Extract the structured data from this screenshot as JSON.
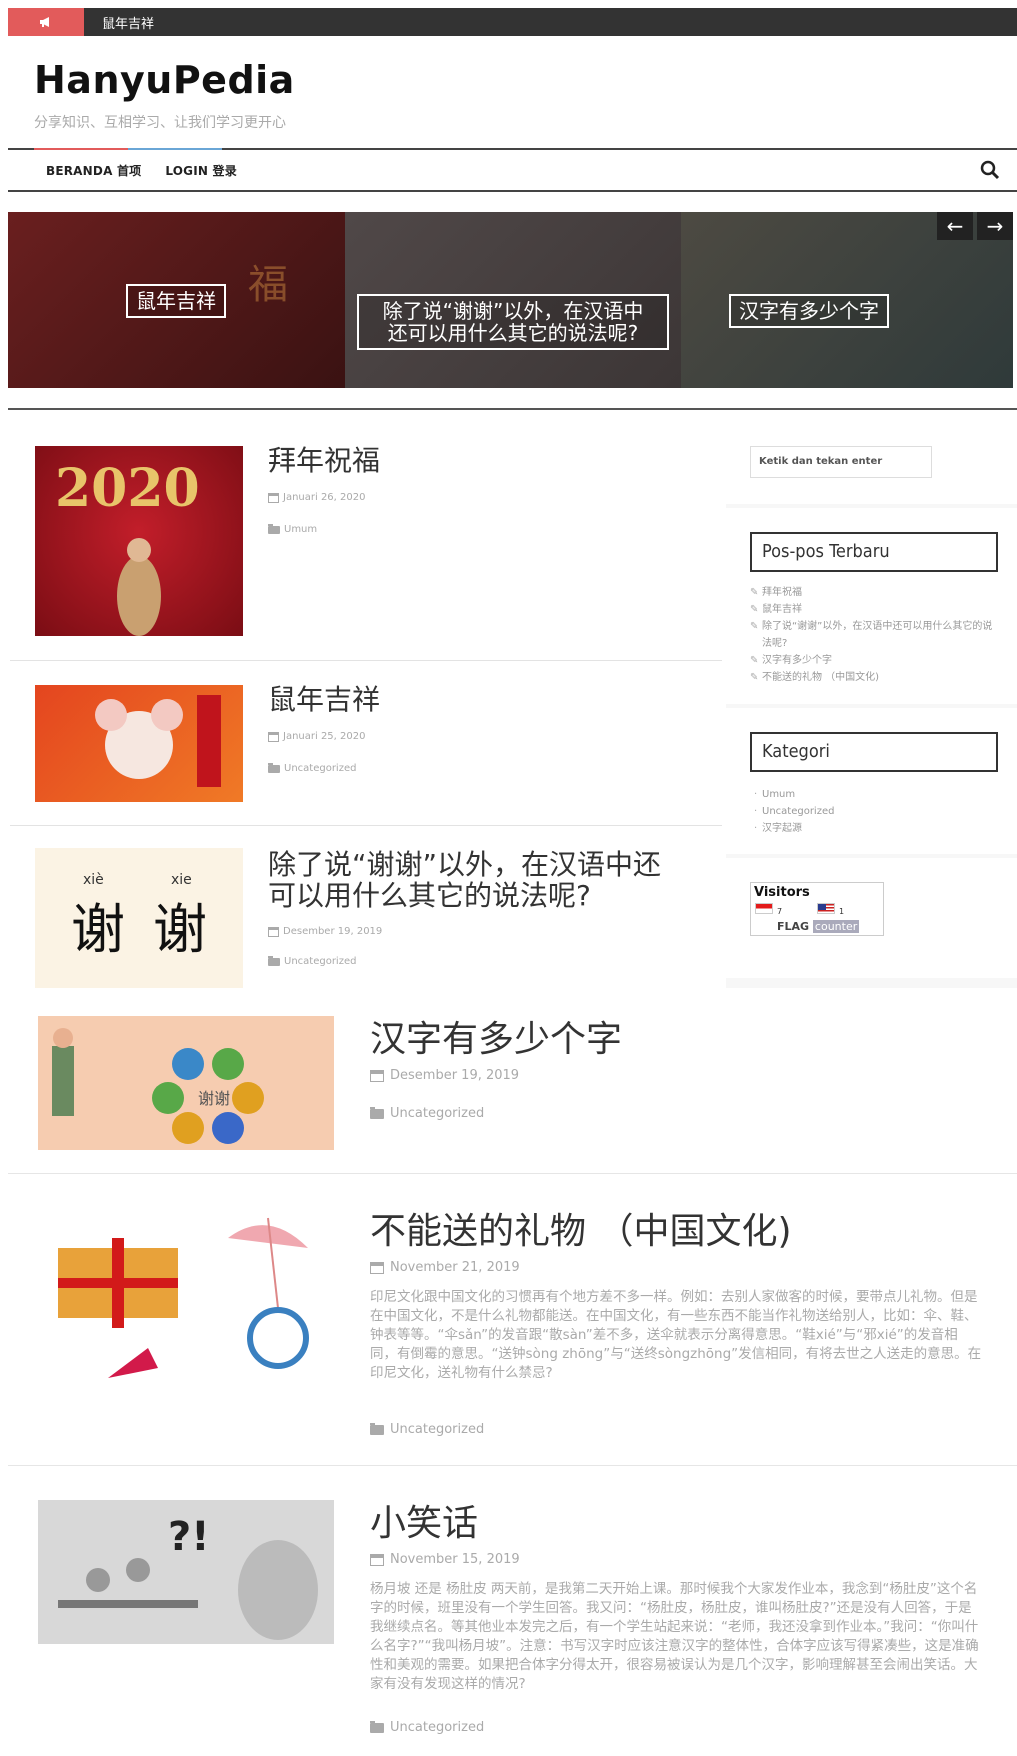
{
  "topbar": {
    "ticker": "鼠年吉祥",
    "icon": "megaphone-icon"
  },
  "header": {
    "brand": "HanyuPedia",
    "tagline": "分享知识、互相学习、让我们学习更开心"
  },
  "nav": {
    "items": [
      "BERANDA 首项",
      "LOGIN 登录"
    ],
    "search_icon": "search-icon"
  },
  "slider": {
    "slides": [
      {
        "caption": "鼠年吉祥"
      },
      {
        "caption_line1": "除了说“谢谢”以外，在汉语中",
        "caption_line2": "还可以用什么其它的说法呢?"
      },
      {
        "caption": "汉字有多少个字"
      }
    ],
    "prev": "←",
    "next": "→"
  },
  "posts": [
    {
      "title": "拜年祝福",
      "date": "Januari 26, 2020",
      "category": "Umum"
    },
    {
      "title": "鼠年吉祥",
      "date": "Januari 25, 2020",
      "category": "Uncategorized"
    },
    {
      "title_line1": "除了说“谢谢”以外，在汉语中还",
      "title_line2": "可以用什么其它的说法呢?",
      "date": "Desember 19, 2019",
      "category": "Uncategorized"
    }
  ],
  "sidebar": {
    "search_placeholder": "Ketik dan tekan enter",
    "recent": {
      "title": "Pos-pos Terbaru",
      "items": [
        "拜年祝福",
        "鼠年吉祥",
        "除了说“谢谢”以外，在汉语中还可以用什么其它的说法呢?",
        "汉字有多少个字",
        "不能送的礼物 （中国文化)"
      ]
    },
    "categories": {
      "title": "Kategori",
      "items": [
        "Umum",
        "Uncategorized",
        "汉字起源"
      ]
    },
    "visitors": {
      "label": "Visitors",
      "id_count": "7",
      "us_count": "1",
      "brand": "FLAG",
      "brand2": "counter"
    }
  },
  "posts2": [
    {
      "title": "汉字有多少个字",
      "date": "Desember 19, 2019",
      "category": "Uncategorized"
    },
    {
      "title": "不能送的礼物 （中国文化)",
      "date": "November 21, 2019",
      "category": "Uncategorized",
      "excerpt": "印尼文化跟中国文化的习惯再有个地方差不多一样。例如：去别人家做客的时候，要带点儿礼物。但是在中国文化，不是什么礼物都能送。在中国文化，有一些东西不能当作礼物送给别人，比如：伞、鞋、钟表等等。“伞sǎn”的发音跟“散sàn”差不多，送伞就表示分离得意思。“鞋xié”与“邪xié”的发音相同，有倒霉的意思。“送钟sòng zhōng”与“送终sòngzhōng”发信相同，有将去世之人送走的意思。在印尼文化，送礼物有什么禁忌?"
    },
    {
      "title": "小笑话",
      "date": "November 15, 2019",
      "category": "Uncategorized",
      "excerpt": "杨月坡 还是 杨肚皮 两天前，是我第二天开始上课。那时候我个大家发作业本，我念到“杨肚皮”这个名字的时候，班里没有一个学生回答。我又问：“杨肚皮，杨肚皮，谁叫杨肚皮?”还是没有人回答，于是我继续点名。等其他业本发完之后，有一个学生站起来说：“老师，我还没拿到作业本。”我问：“你叫什么名字?”“我叫杨月坡”。注意：书写汉字时应该注意汉字的整体性，合体字应该写得紧凑些，这是准确性和美观的需要。如果把合体字分得太开，很容易被误认为是几个汉字，影响理解甚至会闹出笑话。大家有没有发现这样的情况?"
    }
  ],
  "colors": {
    "accent_red": "#e25b5b",
    "accent_blue": "#6aa6d6",
    "dark": "#333333"
  }
}
